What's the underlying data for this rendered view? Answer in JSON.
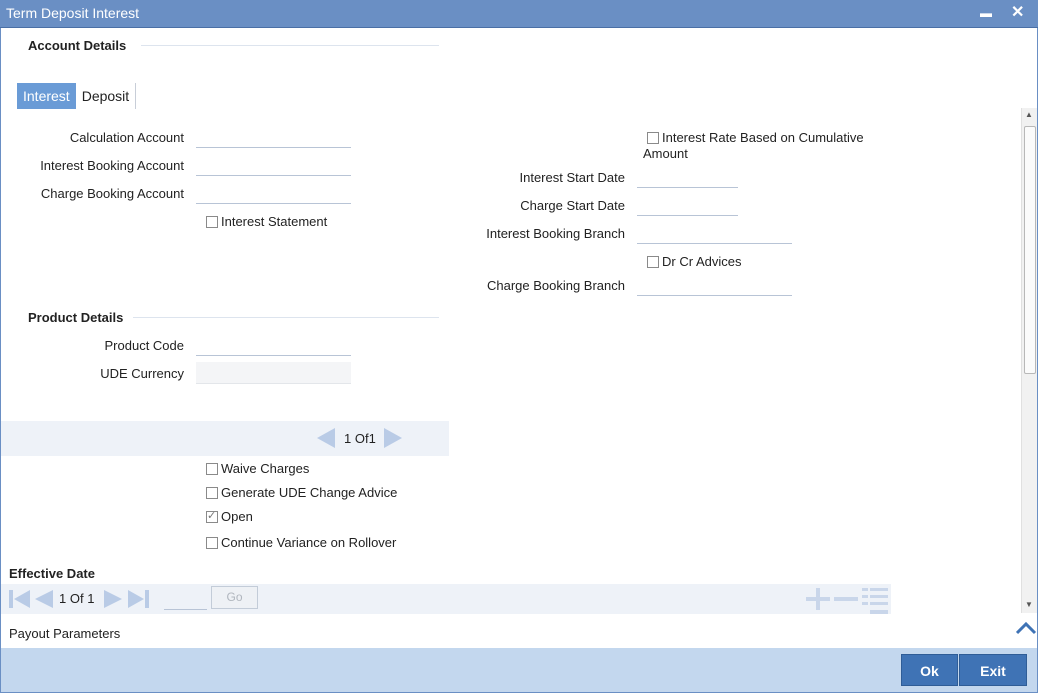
{
  "window": {
    "title": "Term Deposit Interest",
    "minimize_glyph": "▬",
    "close_glyph": "✕"
  },
  "account_details": {
    "title": "Account Details"
  },
  "tabs": [
    {
      "label": "Interest"
    },
    {
      "label": "Deposit"
    }
  ],
  "interest_tab": {
    "calculation_account": {
      "label": "Calculation Account",
      "value": ""
    },
    "interest_booking_account": {
      "label": "Interest Booking Account",
      "value": ""
    },
    "charge_booking_account": {
      "label": "Charge Booking Account",
      "value": ""
    },
    "interest_statement": {
      "label": "Interest Statement",
      "checked": false
    },
    "rate_based_cumulative": {
      "label": "Interest Rate Based on Cumulative",
      "label2": "Amount",
      "checked": false
    },
    "interest_start_date": {
      "label": "Interest Start Date",
      "value": ""
    },
    "charge_start_date": {
      "label": "Charge Start Date",
      "value": ""
    },
    "interest_booking_branch": {
      "label": "Interest Booking Branch",
      "value": ""
    },
    "dr_cr_advices": {
      "label": "Dr Cr Advices",
      "checked": false
    },
    "charge_booking_branch": {
      "label": "Charge Booking Branch",
      "value": ""
    }
  },
  "product_details": {
    "title": "Product Details",
    "product_code": {
      "label": "Product Code",
      "value": ""
    },
    "ude_currency": {
      "label": "UDE Currency",
      "value": ""
    }
  },
  "product_pager": {
    "current": "1",
    "of_label": "Of",
    "total": "1"
  },
  "options": [
    {
      "label": "Waive Charges",
      "checked": false
    },
    {
      "label": "Generate UDE Change Advice",
      "checked": false
    },
    {
      "label": "Open",
      "checked": true
    },
    {
      "label": "Continue Variance on Rollover",
      "checked": false
    }
  ],
  "effective_date": {
    "title": "Effective Date",
    "pager": {
      "current": "1",
      "of_label": "Of",
      "total": "1"
    },
    "go_label": "Go"
  },
  "payout_parameters": {
    "label": "Payout Parameters"
  },
  "footer": {
    "ok_label": "Ok",
    "exit_label": "Exit"
  },
  "colors": {
    "titlebar": "#6a8fc4",
    "accent_button": "#3f73b5",
    "footer_band": "#c3d7ee",
    "active_tab": "#6a9bd6"
  }
}
